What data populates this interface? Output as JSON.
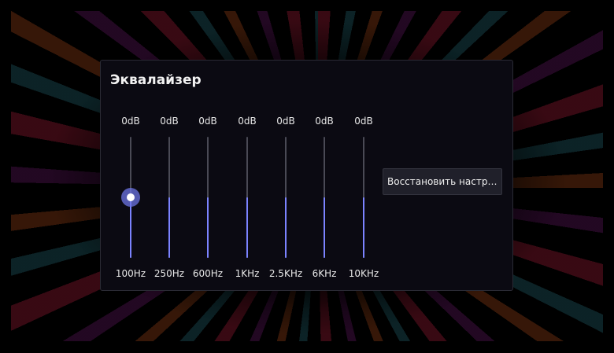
{
  "dialog": {
    "title": "Эквалайзер",
    "reset_label": "Восстановить настро…"
  },
  "equalizer": {
    "bands": [
      {
        "db_label": "0dB",
        "freq": "100Hz",
        "level": 0.5,
        "focused": true
      },
      {
        "db_label": "0dB",
        "freq": "250Hz",
        "level": 0.5,
        "focused": false
      },
      {
        "db_label": "0dB",
        "freq": "600Hz",
        "level": 0.5,
        "focused": false
      },
      {
        "db_label": "0dB",
        "freq": "1KHz",
        "level": 0.5,
        "focused": false
      },
      {
        "db_label": "0dB",
        "freq": "2.5KHz",
        "level": 0.5,
        "focused": false
      },
      {
        "db_label": "0dB",
        "freq": "6KHz",
        "level": 0.5,
        "focused": false
      },
      {
        "db_label": "0dB",
        "freq": "10KHz",
        "level": 0.5,
        "focused": false
      }
    ]
  },
  "colors": {
    "accent": "#7b83ff",
    "panel": "#0b0a12"
  }
}
